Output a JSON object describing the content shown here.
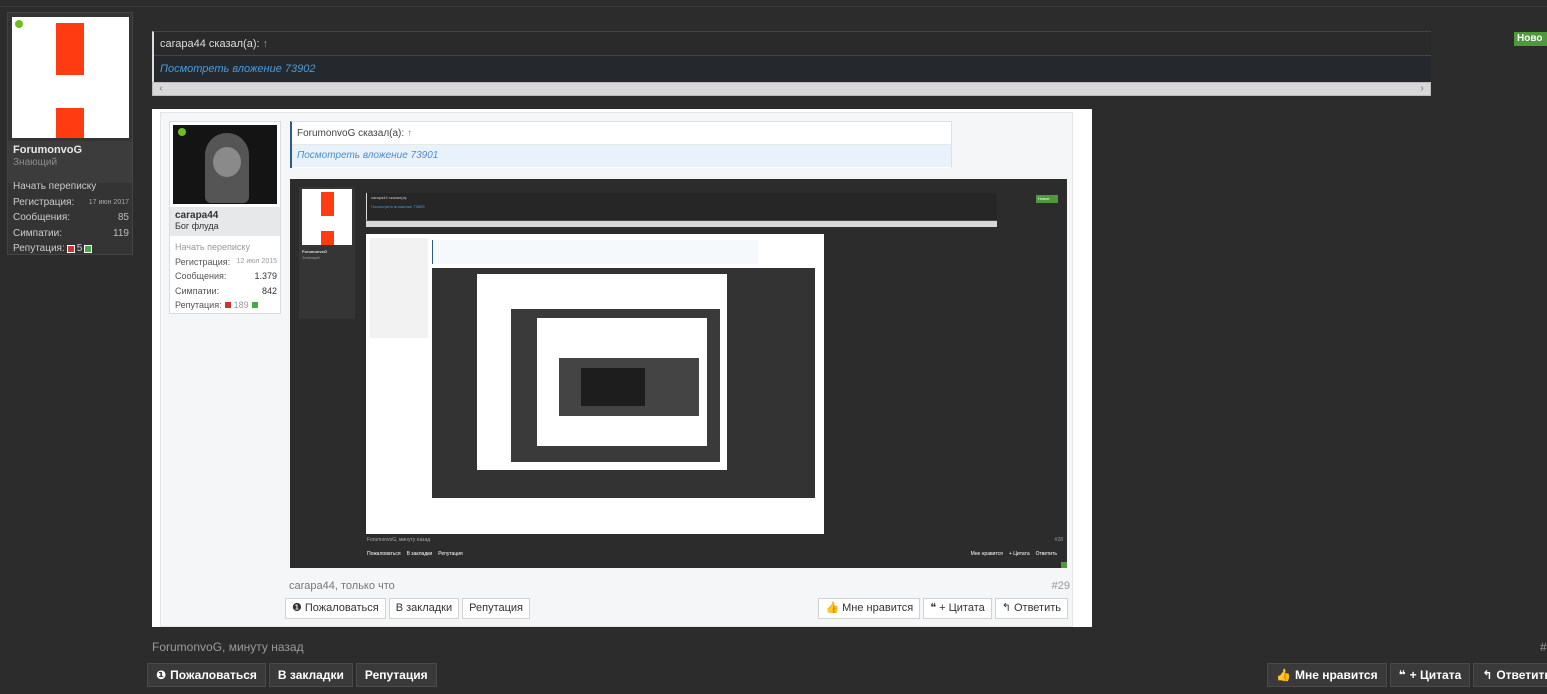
{
  "user_card": {
    "username": "ForumonvoG",
    "title": "Знающий",
    "start_conversation": "Начать переписку",
    "registration_label": "Регистрация:",
    "registration_value": "17 июн 2017",
    "messages_label": "Сообщения:",
    "messages_value": "85",
    "likes_label": "Симпатии:",
    "likes_value": "119",
    "reputation_label": "Репутация:",
    "reputation_value": "5"
  },
  "quote_top": {
    "author_line": "сarapa44 сказал(а):",
    "attachment": "Посмотреть вложение 73902"
  },
  "new_badge": "Ново",
  "embedded": {
    "user_card": {
      "username": "сarapa44",
      "title": "Бог флуда",
      "start_conversation": "Начать переписку",
      "registration_label": "Регистрация:",
      "registration_value": "12 июл 2015",
      "messages_label": "Сообщения:",
      "messages_value": "1.379",
      "likes_label": "Симпатии:",
      "likes_value": "842",
      "reputation_label": "Репутация:",
      "reputation_value": "189"
    },
    "quote": {
      "author_line": "ForumonvoG сказал(а):",
      "attachment": "Посмотреть вложение 73901"
    },
    "inner": {
      "username": "ForumonvoG",
      "title": "Знающий",
      "quote_author": "сarapa44 сказал(а):",
      "quote_attachment": "Посмотреть вложение 73899",
      "new_badge": "Новое",
      "meta": "ForumonvoG, минуту назад",
      "post_number": "#28",
      "buttons_left": [
        "Пожаловаться",
        "В закладки",
        "Репутация"
      ],
      "buttons_right": [
        "Мне нравится",
        "+ Цитата",
        "Ответить"
      ]
    },
    "meta": "сarapa44, только что",
    "post_number": "#29",
    "buttons": {
      "report": "Пожаловаться",
      "bookmark": "В закладки",
      "reputation": "Репутация",
      "like": "Мне нравится",
      "quote": "+ Цитата",
      "reply": "Ответить"
    }
  },
  "post_footer": {
    "meta": "ForumonvoG, минуту назад",
    "post_number": "#",
    "buttons": {
      "report": "Пожаловаться",
      "bookmark": "В закладки",
      "reputation": "Репутация",
      "like": "Мне нравится",
      "quote": "+ Цитата",
      "reply": "Ответить"
    }
  },
  "colors": {
    "background": "#2c2c2c",
    "accent_green": "#4e9a3a",
    "link_blue": "#4a9ad8",
    "logo_red": "#ff3b12"
  }
}
